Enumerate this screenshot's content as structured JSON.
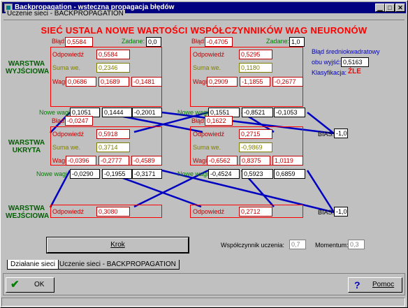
{
  "window": {
    "title": "Backpropagation - wsteczna propagacja błędów",
    "controls": {
      "minimize": "▁",
      "maximize": "□",
      "close": "✕"
    }
  },
  "group_label": "Uczenie sieci - BACKPROPAGATION",
  "headline": "SIEĆ USTALA NOWE WARTOŚCI WSPÓŁCZYNNIKÓW WAG NEURONÓW",
  "layers": {
    "output": "WARSTWA WYJŚCIOWA",
    "hidden": "WARSTWA UKRYTA",
    "input": "WARSTWA WEJŚCIOWA"
  },
  "labels": {
    "blad": "Błąd:",
    "zadane": "Zadane:",
    "odpowiedz": "Odpowiedź",
    "suma": "Suma we.",
    "wagi": "Wagi",
    "nowe_wagi": "Nowe wagi",
    "bias": "BIAS:"
  },
  "output_neurons": [
    {
      "blad": "0,5584",
      "zadane": "0,0",
      "odpowiedz": "0,5584",
      "suma": "0,2346",
      "wagi": [
        "0,0686",
        "0,1689",
        "-0,1481"
      ],
      "nowe_wagi": [
        "0,1051",
        "0,1444",
        "-0,2001"
      ]
    },
    {
      "blad": "-0,4705",
      "zadane": "1,0",
      "odpowiedz": "0,5295",
      "suma": "0,1180",
      "wagi": [
        "0,2909",
        "-1,1855",
        "-0,2677"
      ],
      "nowe_wagi": [
        "0,1551",
        "-0,8521",
        "-0,1053"
      ]
    }
  ],
  "hidden_neurons": [
    {
      "blad": "-0,0247",
      "odpowiedz": "0,5918",
      "suma": "0,3714",
      "wagi": [
        "-0,0396",
        "-0,2777",
        "-0,4589"
      ],
      "nowe_wagi": [
        "-0,0290",
        "-0,1955",
        "-0,3171"
      ]
    },
    {
      "blad": "0,1622",
      "odpowiedz": "0,2715",
      "suma": "-0,9869",
      "wagi": [
        "-0,6562",
        "0,8375",
        "1,0119"
      ],
      "nowe_wagi": [
        "-0,4524",
        "0,5923",
        "0,6859"
      ]
    }
  ],
  "input_neurons": [
    {
      "odpowiedz": "0,3080"
    },
    {
      "odpowiedz": "0,2712"
    }
  ],
  "bias_values": [
    "-1,0",
    "-1,0"
  ],
  "mse": {
    "label_line1": "Błąd średniokwadratowy",
    "label_line2": "obu wyjść:",
    "value": "0,5163",
    "class_label": "Klasyfikacja:",
    "class_value": "ŹLE"
  },
  "controls": {
    "krok": "Krok",
    "lr_label": "Współczynnik uczenia:",
    "lr_value": "0,7",
    "momentum_label": "Momentum:",
    "momentum_value": "0,3"
  },
  "tabs": [
    "Działanie sieci",
    "Uczenie sieci - BACKPROPAGATION"
  ],
  "buttons": {
    "ok": "OK",
    "help": "Pomoc",
    "ok_icon": "✔",
    "help_icon": "?"
  },
  "colors": {
    "title_bar": "#000080",
    "headline": "#ff0000",
    "layer_label": "#006000",
    "line": "#0000c0"
  }
}
